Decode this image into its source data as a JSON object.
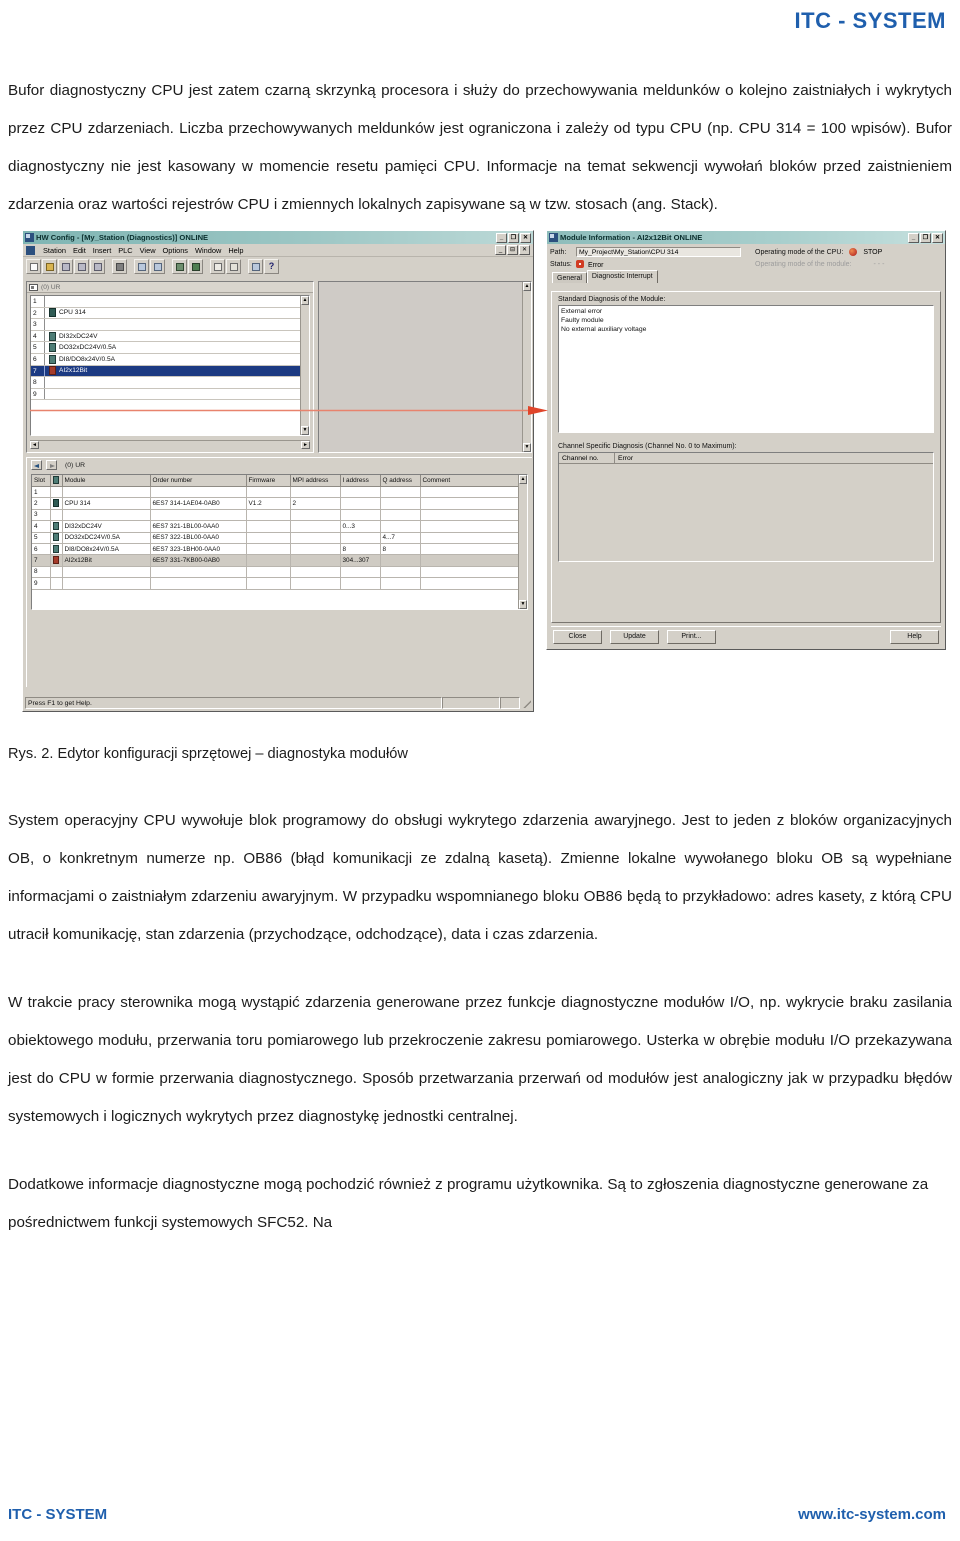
{
  "header": {
    "brand": "ITC - SYSTEM"
  },
  "paragraphs": {
    "p1": "Bufor diagnostyczny CPU jest zatem czarną skrzynką procesora i służy do przechowywania meldunków o kolejno zaistniałych i wykrytych przez CPU zdarzeniach. Liczba przechowywanych meldunków jest ograniczona i zależy od typu CPU (np. CPU 314 = 100 wpisów). Bufor diagnostyczny nie jest kasowany w momencie resetu pamięci CPU. Informacje na temat sekwencji wywołań bloków przed zaistnieniem zdarzenia oraz wartości rejestrów CPU i zmiennych lokalnych zapisywane są w tzw. stosach (ang. Stack).",
    "caption": "Rys. 2. Edytor konfiguracji sprzętowej – diagnostyka modułów",
    "p2": "System operacyjny CPU wywołuje blok programowy do obsługi wykrytego zdarzenia awaryjnego. Jest to jeden z bloków organizacyjnych OB, o konkretnym numerze np. OB86 (błąd komunikacji ze zdalną kasetą). Zmienne lokalne wywołanego bloku OB są wypełniane informacjami o zaistniałym zdarzeniu awaryjnym. W przypadku wspomnianego bloku OB86 będą to przykładowo: adres kasety, z którą CPU utracił komunikację, stan zdarzenia (przychodzące, odchodzące), data i czas zdarzenia.",
    "p3": "W trakcie pracy sterownika mogą wystąpić zdarzenia generowane przez funkcje diagnostyczne modułów I/O, np. wykrycie braku zasilania obiektowego modułu, przerwania toru pomiarowego lub przekroczenie zakresu pomiarowego. Usterka w obrębie modułu I/O przekazywana jest do CPU w formie przerwania diagnostycznego. Sposób przetwarzania przerwań od modułów jest analogiczny jak w przypadku błędów systemowych i logicznych wykrytych przez diagnostykę jednostki centralnej.",
    "p4": "Dodatkowe informacje diagnostyczne mogą pochodzić również z programu użytkownika. Są to zgłoszenia diagnostyczne generowane za pośrednictwem funkcji systemowych SFC52. Na"
  },
  "hw_config": {
    "title": "HW Config - [My_Station (Diagnostics)]  ONLINE",
    "window_buttons": [
      "_",
      "❐",
      "✕"
    ],
    "mdi_buttons": [
      "_",
      "⊟",
      "✕"
    ],
    "menu": [
      "Station",
      "Edit",
      "Insert",
      "PLC",
      "View",
      "Options",
      "Window",
      "Help"
    ],
    "toolbar_icons": [
      "new-file-icon",
      "open-folder-icon",
      "save-download-icon",
      "save-icon",
      "save-memory-icon",
      "print-icon",
      "copy-icon",
      "paste-icon",
      "download-to-plc-icon",
      "upload-from-plc-icon",
      "module-window-icon",
      "catalog-window-icon",
      "diagnostics-icon",
      "help-pointer-icon"
    ],
    "rack_label": "(0) UR",
    "rack_rows": [
      {
        "slot": "1",
        "module": "",
        "icon": "blank"
      },
      {
        "slot": "2",
        "module": "CPU 314",
        "icon": "cpu"
      },
      {
        "slot": "3",
        "module": "",
        "icon": "blank"
      },
      {
        "slot": "4",
        "module": "DI32xDC24V",
        "icon": "green"
      },
      {
        "slot": "5",
        "module": "DO32xDC24V/0.5A",
        "icon": "green"
      },
      {
        "slot": "6",
        "module": "DI8/DO8x24V/0.5A",
        "icon": "green"
      },
      {
        "slot": "7",
        "module": "AI2x12Bit",
        "icon": "red",
        "selected": true
      },
      {
        "slot": "8",
        "module": "",
        "icon": "blank"
      },
      {
        "slot": "9",
        "module": "",
        "icon": "blank"
      }
    ],
    "detail_rack_label": "(0)  UR",
    "table_headers": [
      "Slot",
      "",
      "Module",
      "Order number",
      "Firmware",
      "MPI address",
      "I address",
      "Q address",
      "Comment"
    ],
    "table_rows": [
      {
        "slot": "1",
        "icon": "none",
        "module": "",
        "order": "",
        "firmware": "",
        "mpi": "",
        "i": "",
        "q": "",
        "comment": ""
      },
      {
        "slot": "2",
        "icon": "cpu",
        "module": "CPU 314",
        "order": "6ES7 314-1AE04-0AB0",
        "firmware": "V1.2",
        "mpi": "2",
        "i": "",
        "q": "",
        "comment": ""
      },
      {
        "slot": "3",
        "icon": "none",
        "module": "",
        "order": "",
        "firmware": "",
        "mpi": "",
        "i": "",
        "q": "",
        "comment": ""
      },
      {
        "slot": "4",
        "icon": "green",
        "module": "DI32xDC24V",
        "order": "6ES7 321-1BL00-0AA0",
        "firmware": "",
        "mpi": "",
        "i": "0...3",
        "q": "",
        "comment": ""
      },
      {
        "slot": "5",
        "icon": "green",
        "module": "DO32xDC24V/0.5A",
        "order": "6ES7 322-1BL00-0AA0",
        "firmware": "",
        "mpi": "",
        "i": "",
        "q": "4...7",
        "comment": ""
      },
      {
        "slot": "6",
        "icon": "green",
        "module": "DI8/DO8x24V/0.5A",
        "order": "6ES7 323-1BH00-0AA0",
        "firmware": "",
        "mpi": "",
        "i": "8",
        "q": "8",
        "comment": ""
      },
      {
        "slot": "7",
        "icon": "red",
        "module": "AI2x12Bit",
        "order": "6ES7 331-7KB00-0AB0",
        "firmware": "",
        "mpi": "",
        "i": "304...307",
        "q": "",
        "comment": "",
        "selected": true
      },
      {
        "slot": "8",
        "icon": "none",
        "module": "",
        "order": "",
        "firmware": "",
        "mpi": "",
        "i": "",
        "q": "",
        "comment": ""
      },
      {
        "slot": "9",
        "icon": "none",
        "module": "",
        "order": "",
        "firmware": "",
        "mpi": "",
        "i": "",
        "q": "",
        "comment": ""
      }
    ],
    "statusbar": "Press F1 to get Help."
  },
  "module_info": {
    "title": "Module Information - AI2x12Bit  ONLINE",
    "window_buttons": [
      "_",
      "❐",
      "✕"
    ],
    "path_label": "Path:",
    "path_value": "My_Project\\My_Station\\CPU 314",
    "status_label": "Status:",
    "status_value": "Error",
    "cpu_mode_label": "Operating mode of the  CPU:",
    "cpu_mode_value": "STOP",
    "module_mode_label": "Operating mode of the module:",
    "module_mode_value": "- - -",
    "tabs": [
      {
        "label": "General",
        "active": false
      },
      {
        "label": "Diagnostic Interrupt",
        "active": true
      }
    ],
    "std_diag_label": "Standard Diagnosis of the Module:",
    "std_diag_items": [
      "External error",
      "Faulty module",
      "No external auxiliary voltage"
    ],
    "channel_diag_label": "Channel Specific Diagnosis (Channel No. 0 to Maximum):",
    "channel_headers": [
      "Channel no.",
      "Error"
    ],
    "channel_rows": [],
    "buttons": [
      "Close",
      "Update",
      "Print...",
      "Help"
    ]
  },
  "footer": {
    "left": "ITC - SYSTEM",
    "right": "www.itc-system.com"
  },
  "colors": {
    "brand_blue": "#1f5fad",
    "titlebar_teal": "#7fb5b3",
    "selection_blue": "#1c3a82",
    "error_red": "#c0392b",
    "arrow_red": "#e0452a"
  }
}
